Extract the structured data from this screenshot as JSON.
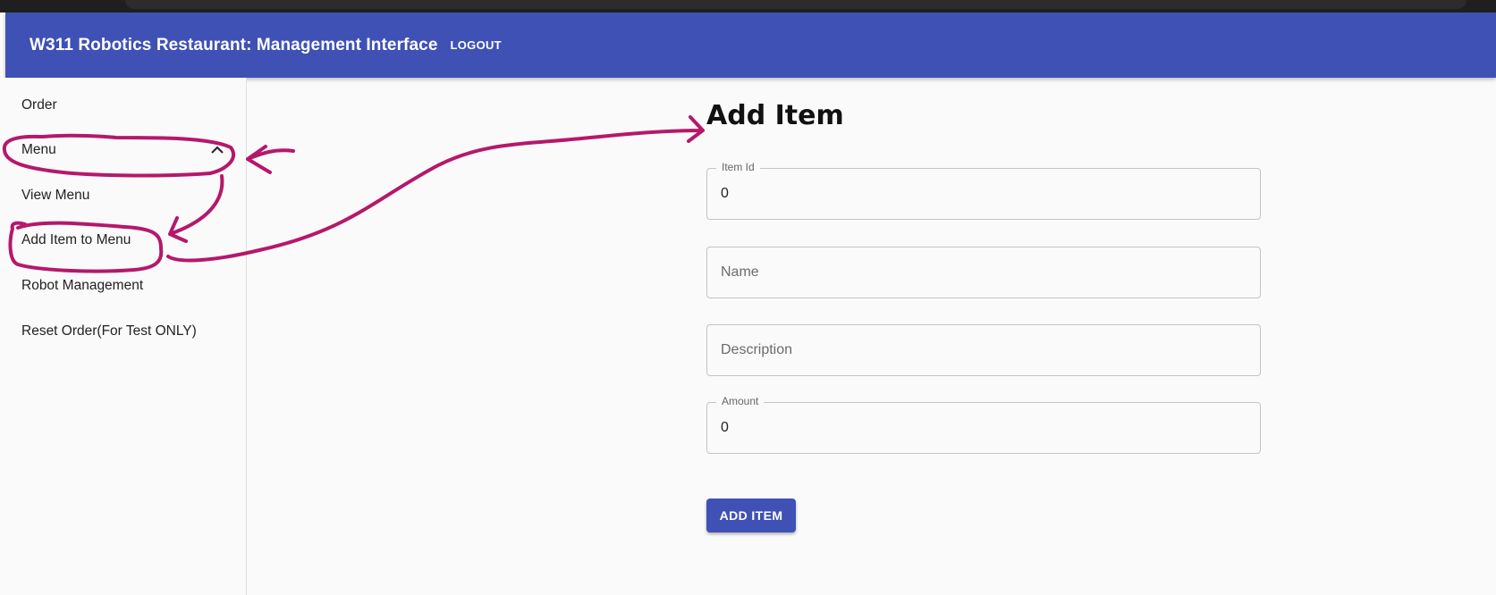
{
  "appbar": {
    "title": "W311 Robotics Restaurant: Management Interface",
    "logout_label": "LOGOUT",
    "color": "#3f51b5"
  },
  "sidebar": {
    "items": [
      {
        "label": "Order"
      },
      {
        "label": "Menu",
        "expanded": true,
        "icon": "chevron-up-icon"
      },
      {
        "label": "View Menu"
      },
      {
        "label": "Add Item to Menu"
      },
      {
        "label": "Robot Management"
      },
      {
        "label": "Reset Order(For Test ONLY)"
      }
    ]
  },
  "form": {
    "title": "Add Item",
    "item_id": {
      "label": "Item Id",
      "value": "0"
    },
    "name": {
      "placeholder": "Name",
      "value": ""
    },
    "description": {
      "placeholder": "Description",
      "value": ""
    },
    "amount": {
      "label": "Amount",
      "value": "0"
    },
    "submit_label": "ADD ITEM"
  },
  "annotation": {
    "color": "#b5186b"
  }
}
